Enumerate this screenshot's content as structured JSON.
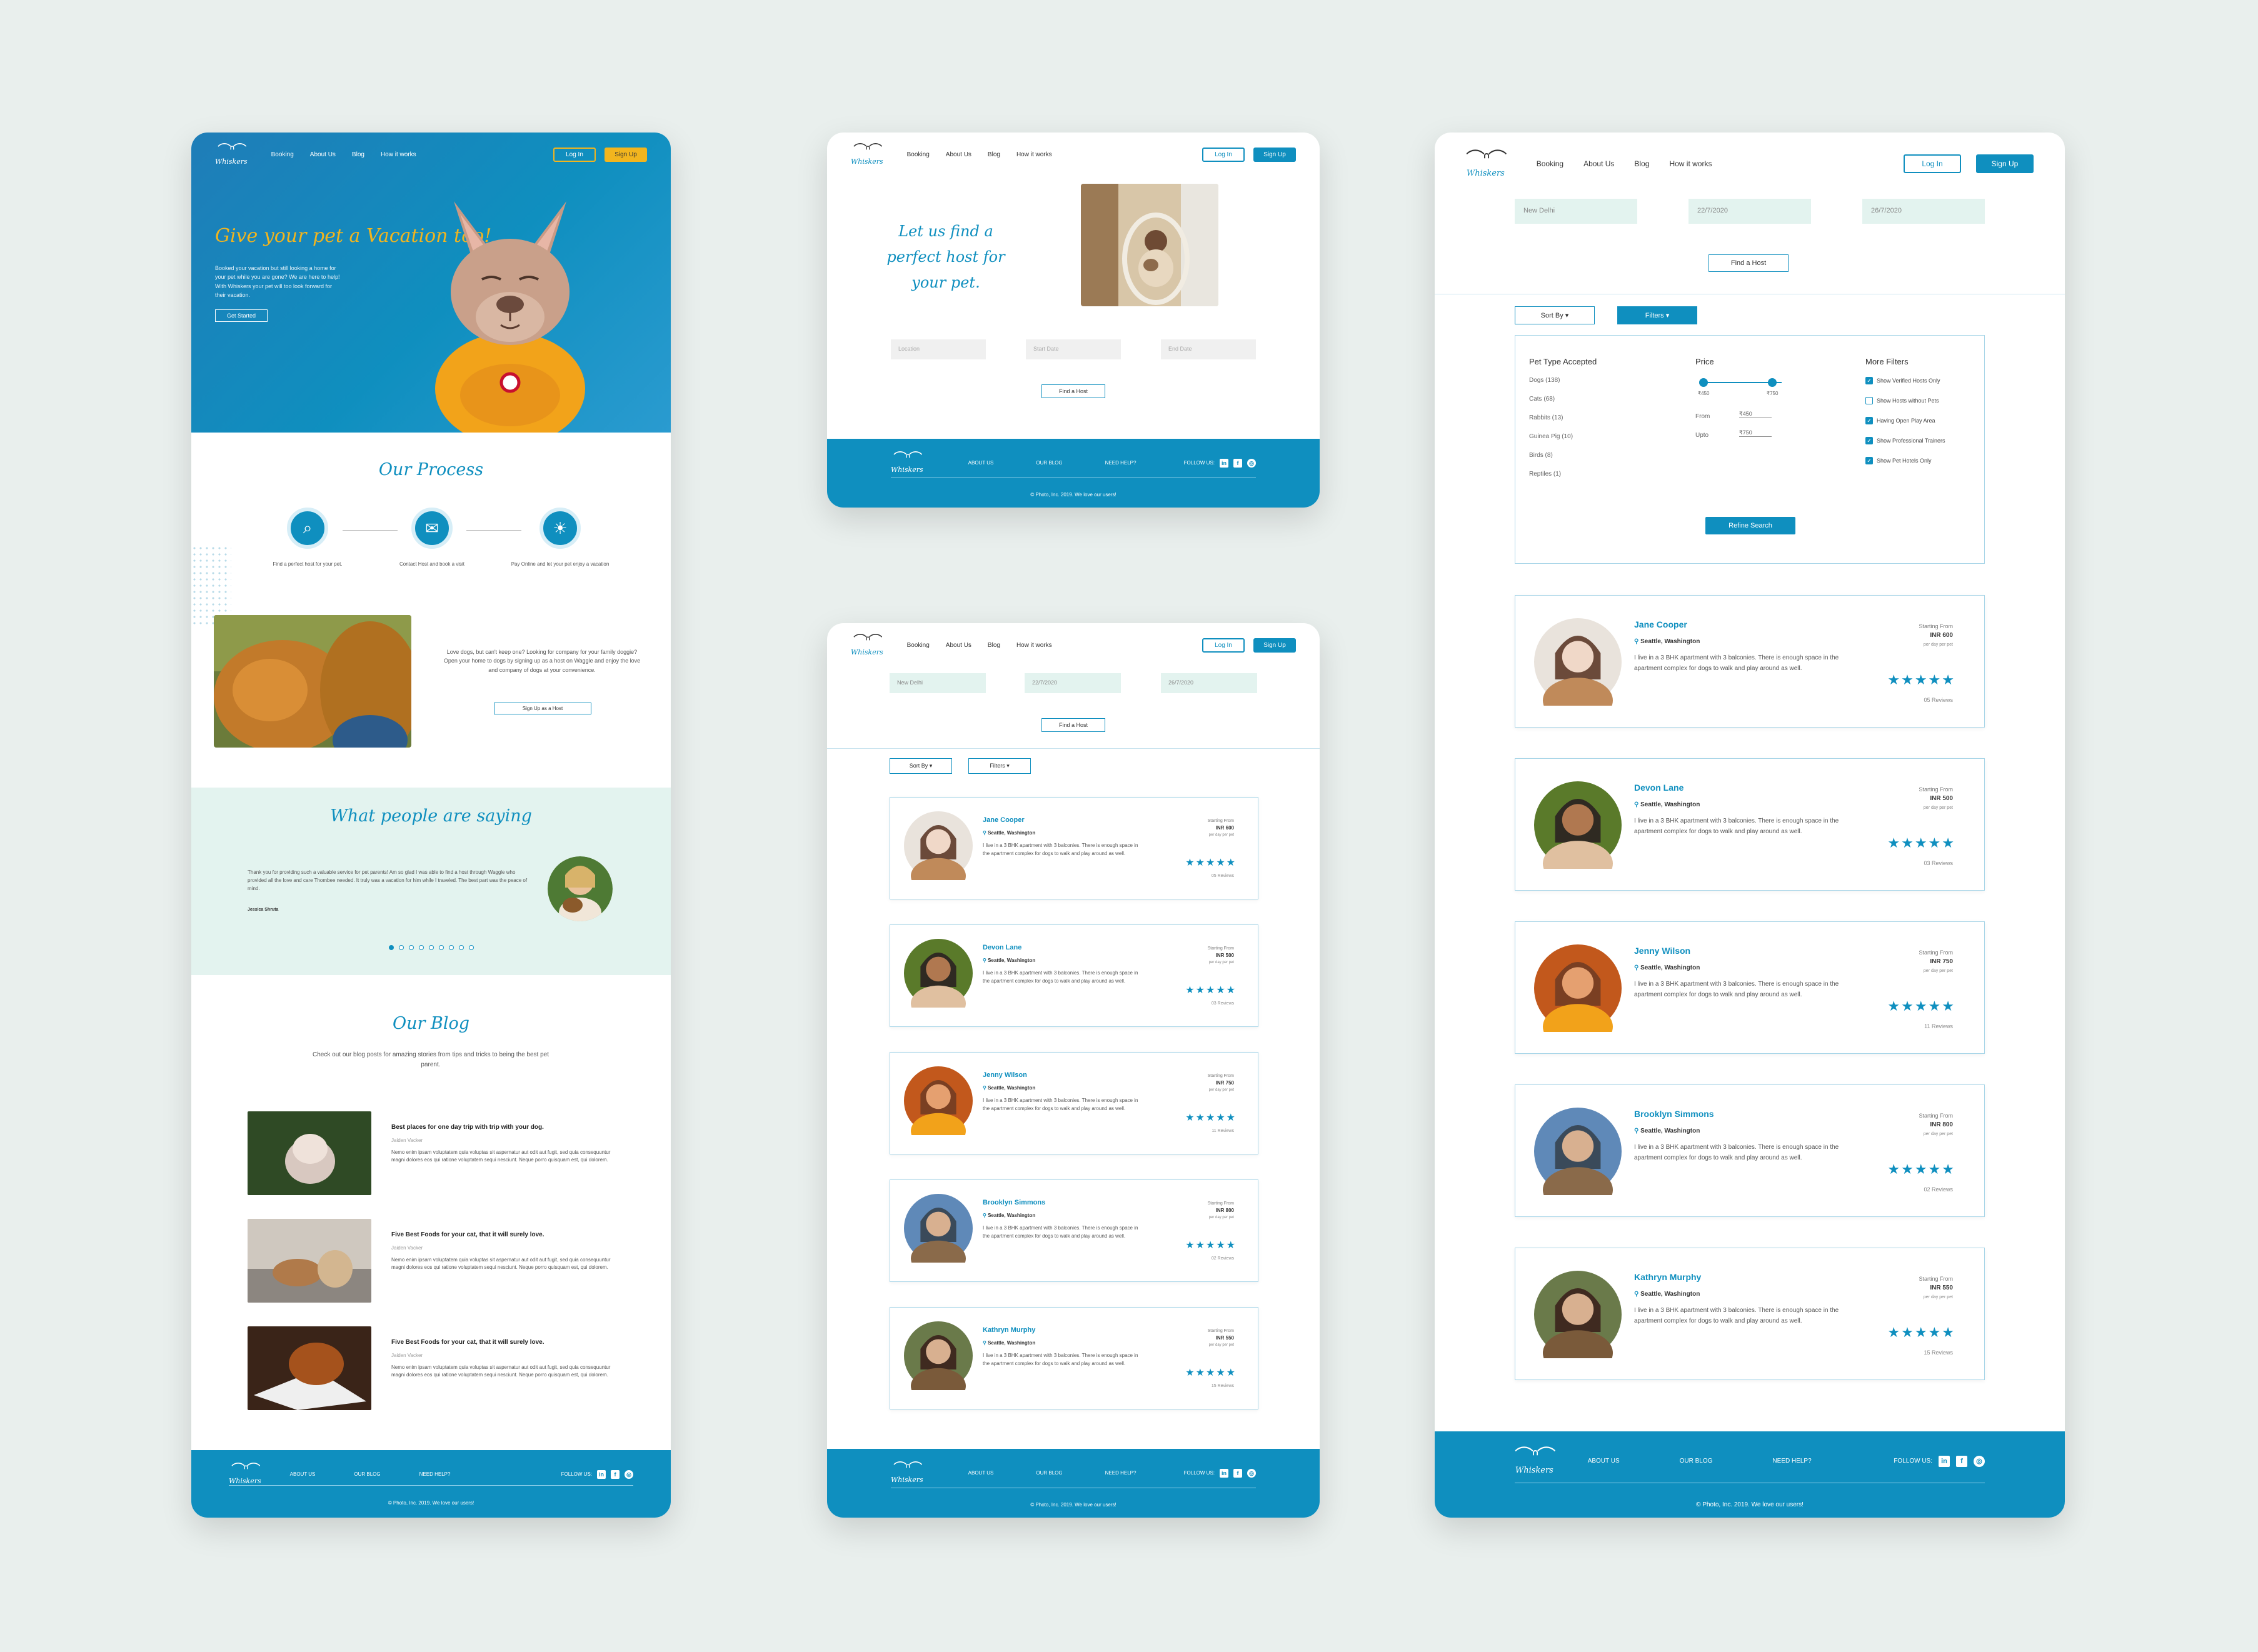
{
  "brand": {
    "name": "Whiskers"
  },
  "nav": {
    "items": [
      "Booking",
      "About Us",
      "Blog",
      "How it works"
    ],
    "login": "Log In",
    "signup": "Sign Up"
  },
  "footer": {
    "links": [
      "ABOUT US",
      "OUR BLOG",
      "NEED HELP?"
    ],
    "follow": "FOLLOW US:",
    "copyright": "© Photo, Inc. 2019. We love our users!"
  },
  "home": {
    "hero": {
      "title": "Give your pet a Vacation too!",
      "text": "Booked your vacation but still looking a home for your pet while you are gone? We are here to help! With Whiskers your pet will too look forward for their vacation.",
      "cta": "Get Started"
    },
    "process": {
      "title": "Our Process",
      "steps": [
        "Find a perfect host for your pet.",
        "Contact Host and book a visit",
        "Pay Online and let your pet enjoy a vacation"
      ]
    },
    "host_promo": {
      "text": "Love dogs, but can't keep one? Looking for company for your family doggie? Open your home to dogs by signing up as a host on Waggle and enjoy the love and company of dogs at your convenience.",
      "cta": "Sign Up as a Host"
    },
    "testimonial": {
      "title": "What people are saying",
      "quote": "Thank you for providing such a valuable service for pet parents! Am so glad I was able to find a host through Waggle who provided all the love and care Thombee needed. It truly was a vacation for him while I traveled. The best part was the peace of mind.",
      "author": "Jessica Shruta"
    },
    "blog": {
      "title": "Our Blog",
      "subtitle": "Check out our blog posts for amazing stories from tips and tricks to being the best pet parent.",
      "posts": [
        {
          "title": "Best places for one day trip with trip with your dog.",
          "author": "Jaiden Vacker",
          "excerpt": "Nemo enim ipsam voluptatem quia voluptas sit aspernatur aut odit aut fugit, sed quia consequuntur magni dolores eos qui ratione voluptatem sequi nesciunt. Neque porro quisquam est, qui dolorem."
        },
        {
          "title": "Five Best Foods for your cat, that it will surely love.",
          "author": "Jaiden Vacker",
          "excerpt": "Nemo enim ipsam voluptatem quia voluptas sit aspernatur aut odit aut fugit, sed quia consequuntur magni dolores eos qui ratione voluptatem sequi nesciunt. Neque porro quisquam est, qui dolorem."
        },
        {
          "title": "Five Best Foods for your cat, that it will surely love.",
          "author": "Jaiden Vacker",
          "excerpt": "Nemo enim ipsam voluptatem quia voluptas sit aspernatur aut odit aut fugit, sed quia consequuntur magni dolores eos qui ratione voluptatem sequi nesciunt. Neque porro quisquam est, qui dolorem."
        }
      ]
    }
  },
  "search": {
    "title": "Let us find a perfect host for your pet.",
    "location_placeholder": "Location",
    "start_placeholder": "Start Date",
    "end_placeholder": "End Date",
    "button": "Find a Host"
  },
  "results": {
    "location": "New Delhi",
    "start": "22/7/2020",
    "end": "26/7/2020",
    "find": "Find a Host",
    "sort": "Sort By ▾",
    "filters": "Filters ▾",
    "starting_from": "Starting From",
    "per_day": "per day per pet",
    "stars": "★★★★★",
    "hosts": [
      {
        "name": "Jane Cooper",
        "location": "Seattle, Washington",
        "desc": "I live in a 3 BHK apartment with 3 balconies. There is enough space in the apartment complex for dogs to walk and play around as well.",
        "price": "INR 600",
        "reviews": "05 Reviews"
      },
      {
        "name": "Devon Lane",
        "location": "Seattle, Washington",
        "desc": "I live in a 3 BHK apartment with 3 balconies. There is enough space in the apartment complex for dogs to walk and play around as well.",
        "price": "INR 500",
        "reviews": "03 Reviews"
      },
      {
        "name": "Jenny Wilson",
        "location": "Seattle, Washington",
        "desc": "I live in a 3 BHK apartment with 3 balconies. There is enough space in the apartment complex for dogs to walk and play around as well.",
        "price": "INR 750",
        "reviews": "11 Reviews"
      },
      {
        "name": "Brooklyn Simmons",
        "location": "Seattle, Washington",
        "desc": "I live in a 3 BHK apartment with 3 balconies. There is enough space in the apartment complex for dogs to walk and play around as well.",
        "price": "INR 800",
        "reviews": "02 Reviews"
      },
      {
        "name": "Kathryn Murphy",
        "location": "Seattle, Washington",
        "desc": "I live in a 3 BHK apartment with 3 balconies. There is enough space in the apartment complex for dogs to walk and play around as well.",
        "price": "INR 550",
        "reviews": "15 Reviews"
      }
    ],
    "filter_panel": {
      "pet_title": "Pet Type Accepted",
      "pets": [
        "Dogs (138)",
        "Cats (68)",
        "Rabbits (13)",
        "Guinea Pig (10)",
        "Birds (8)",
        "Reptiles (1)"
      ],
      "price_title": "Price",
      "min_label": "₹450",
      "max_label": "₹750",
      "from_label": "From",
      "from_value": "₹450",
      "upto_label": "Upto",
      "upto_value": "₹750",
      "more_title": "More Filters",
      "more": [
        {
          "label": "Show Verified Hosts Only",
          "checked": true
        },
        {
          "label": "Show Hosts without Pets",
          "checked": false
        },
        {
          "label": "Having Open Play Area",
          "checked": true
        },
        {
          "label": "Show Professional Trainers",
          "checked": true
        },
        {
          "label": "Show Pet Hotels Only",
          "checked": true
        }
      ],
      "refine": "Refine Search"
    }
  }
}
